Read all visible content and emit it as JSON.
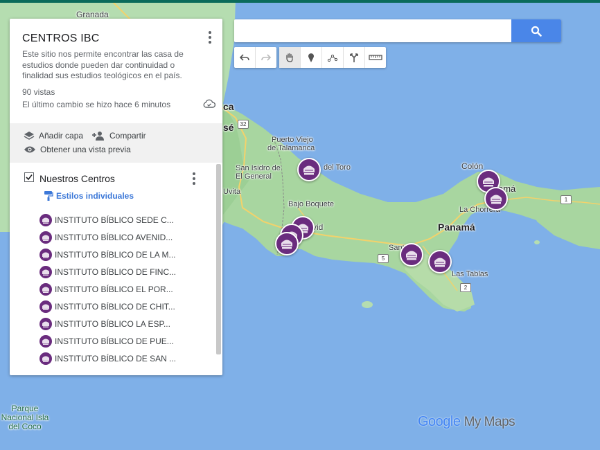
{
  "panel": {
    "title": "CENTROS IBC",
    "description": "Este sitio nos permite encontrar las casa de estudios donde pueden dar continuidad o finalidad sus estudios teológicos en el país.",
    "views": "90 vistas",
    "last_change": "El último cambio se hizo hace 6 minutos",
    "actions": {
      "add_layer": "Añadir capa",
      "share": "Compartir",
      "preview": "Obtener una vista previa"
    },
    "layer": {
      "name": "Nuestros Centros",
      "checked": true,
      "style_label": "Estilos individuales",
      "items": [
        "INSTITUTO BÍBLICO SEDE C...",
        "INSTITUTO BÍBLICO AVENID...",
        "INSTITUTO BÍBLICO DE LA M...",
        "INSTITUTO BÍBLICO DE FINC...",
        "INSTITUTO BÍBLICO EL POR...",
        "INSTITUTO BÍBLICO DE CHIT...",
        "INSTITUTO BÍBLICO LA ESP...",
        "INSTITUTO BÍBLICO DE PUE...",
        "INSTITUTO BÍBLICO DE SAN ..."
      ]
    }
  },
  "search": {
    "value": "",
    "placeholder": ""
  },
  "toolbar": [
    "undo-icon",
    "redo-icon",
    "hand-icon",
    "marker-icon",
    "draw-line-icon",
    "directions-icon",
    "ruler-icon"
  ],
  "map": {
    "labels": {
      "granada": "Granada",
      "ca": "ca",
      "se": "sé",
      "puerto_viejo": "Puerto Viejo",
      "talamanca": "de Talamanca",
      "san_isidro": "San Isidro de",
      "el_general": "El General",
      "uvita": "Uvita",
      "del_toro": "del Toro",
      "bajo_boquete": "Bajo Boquete",
      "vid": "vid",
      "colon": "Colón",
      "panama_city": "amá",
      "la_chorrera": "La Chorrera",
      "panama": "Panamá",
      "santiago": "Sant",
      "las_tablas": "Las Tablas",
      "park": "Parque Nacional Isla del Coco"
    },
    "routes": [
      "32",
      "5",
      "2",
      "1"
    ],
    "marker_color": "#6a2c7e",
    "marker_count": 9
  },
  "brand": {
    "google": "Google",
    "mymaps": "My Maps"
  }
}
